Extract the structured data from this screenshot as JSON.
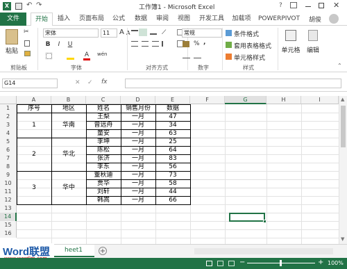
{
  "window": {
    "title": "工作簿1 - Microsoft Excel",
    "user": "胡俊"
  },
  "ribbon_tabs": [
    {
      "label": "文件"
    },
    {
      "label": "开始"
    },
    {
      "label": "插入"
    },
    {
      "label": "页面布局"
    },
    {
      "label": "公式"
    },
    {
      "label": "数据"
    },
    {
      "label": "审阅"
    },
    {
      "label": "视图"
    },
    {
      "label": "开发工具"
    },
    {
      "label": "加载项"
    },
    {
      "label": "POWERPIVOT"
    }
  ],
  "ribbon": {
    "paste_label": "粘贴",
    "clipboard_label": "剪贴板",
    "font_name": "宋体",
    "font_size": "11",
    "font_group_label": "字体",
    "align_group_label": "对齐方式",
    "number_format": "常规",
    "number_group_label": "数字",
    "cond_format": "条件格式",
    "table_format": "套用表格格式",
    "cell_style": "单元格样式",
    "style_group_label": "样式",
    "cells_label": "单元格",
    "edit_label": "编辑",
    "bold": "B",
    "italic": "I",
    "underline": "U",
    "font_color": "A",
    "wen": "wén",
    "percent": "%",
    "comma": ",",
    "quick_a": "A"
  },
  "formula_bar": {
    "name_box": "G14",
    "fx": "fx",
    "cancel": "✕",
    "enter": "✓",
    "content": ""
  },
  "columns": [
    "A",
    "B",
    "C",
    "D",
    "E",
    "F",
    "G",
    "H",
    "I"
  ],
  "rows": [
    "1",
    "2",
    "3",
    "4",
    "5",
    "6",
    "7",
    "8",
    "9",
    "10",
    "11",
    "12",
    "13",
    "14",
    "15",
    "16"
  ],
  "table": {
    "headers": [
      "序号",
      "地区",
      "姓名",
      "销售月份",
      "数据"
    ],
    "groups": [
      {
        "seq": "1",
        "region": "华南"
      },
      {
        "seq": "2",
        "region": "华北"
      },
      {
        "seq": "3",
        "region": "华中"
      }
    ],
    "names": [
      "王梨",
      "曾远舟",
      "童安",
      "李坤",
      "陈松",
      "张济",
      "李东",
      "董秋迪",
      "贾华",
      "刘轩",
      "韩嵩"
    ],
    "month": "一月",
    "values": [
      "47",
      "34",
      "63",
      "25",
      "64",
      "83",
      "56",
      "73",
      "58",
      "44",
      "66"
    ]
  },
  "sheetbar": {
    "sheet_tab": "heet1",
    "add": "+"
  },
  "watermark": {
    "text": "Word联盟",
    "url": "www.wordlm.com"
  },
  "status": {
    "zoom": "100%"
  },
  "colors": {
    "accent": "#217346",
    "selection": "#217346"
  }
}
